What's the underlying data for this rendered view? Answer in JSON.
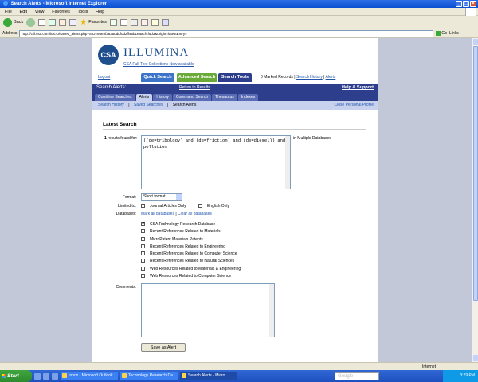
{
  "window": {
    "title": "Search Alerts - Microsoft Internet Explorer",
    "minimize": "_",
    "maximize": "□",
    "close": "×"
  },
  "menu": [
    "File",
    "Edit",
    "View",
    "Favorites",
    "Tools",
    "Help"
  ],
  "toolbar": {
    "back": "Back",
    "favorites": "Favorites"
  },
  "address": {
    "label": "Address",
    "url": "http://ciil.csa.com/ids70/saved_alerts.php?SID=94e3f3835dddf0d2ff45b1eaacf4f5d3&origin=latestEntry=",
    "go": "Go",
    "links": "Links"
  },
  "header": {
    "logo": "CSA",
    "brand": "ILLUMINA",
    "fulltext_link": "CSA Full-Text Collections Now available",
    "logout": "Logout",
    "quick_search": "Quick Search",
    "advanced_search": "Advanced Search",
    "search_tools": "Search Tools",
    "marked_records": "0 Marked Records",
    "search_history": "Search History",
    "alerts": "Alerts",
    "sep": " | "
  },
  "section_bar": {
    "title": "Search Alerts:",
    "return": "Return to Results",
    "help": "Help & Support"
  },
  "tabs": [
    {
      "label": "Combine Searches",
      "active": false
    },
    {
      "label": "Alerts",
      "active": true
    },
    {
      "label": "History",
      "active": false
    },
    {
      "label": "Command Search",
      "active": false
    },
    {
      "label": "Thesaurus",
      "active": false
    },
    {
      "label": "Indexes",
      "active": false
    }
  ],
  "subnav": {
    "search_history": "Search History",
    "saved_searches": "Saved Searches",
    "current": "Search Alerts",
    "sep": "|",
    "close": "Close Personal Profile"
  },
  "main": {
    "heading": "Latest Search",
    "results_count": "1",
    "results_label": " results found for:",
    "query": "((de=tribology) and (de=friction) and (de=diesel)) and pollution",
    "in_databases": "in Multiple Databases",
    "format_label": "Format:",
    "format_value": "Short format",
    "limited_label": "Limited to:",
    "journal_only": "Journal Articles Only",
    "english_only": "English Only",
    "databases_label": "Databases:",
    "mark_all": "Mark all databases",
    "clear_all": "Clear all databases",
    "db_sep": " | ",
    "databases": [
      {
        "name": "CSA Technology Research Database",
        "checked": true
      },
      {
        "name": "Recent References Related to Materials",
        "checked": false
      },
      {
        "name": "MicroPatent Materials Patents",
        "checked": false
      },
      {
        "name": "Recent References Related to Engineering",
        "checked": false
      },
      {
        "name": "Recent References Related to Computer Science",
        "checked": false
      },
      {
        "name": "Recent References Related to Natural Sciences",
        "checked": false
      },
      {
        "name": "Web Resources Related to Materials & Engineering",
        "checked": false
      },
      {
        "name": "Web Resources Related to Computer Science",
        "checked": false
      }
    ],
    "comments_label": "Comments:",
    "save_button": "Save as Alert"
  },
  "status": {
    "zone": "Internet"
  },
  "taskbar": {
    "start": "Start",
    "tasks": [
      {
        "label": "Inbox - Microsoft Outlook",
        "active": false
      },
      {
        "label": "Technology Research Da...",
        "active": false
      },
      {
        "label": "Search Alerts - Micro...",
        "active": true
      }
    ],
    "google": "Google",
    "clock": "3:29 PM"
  }
}
